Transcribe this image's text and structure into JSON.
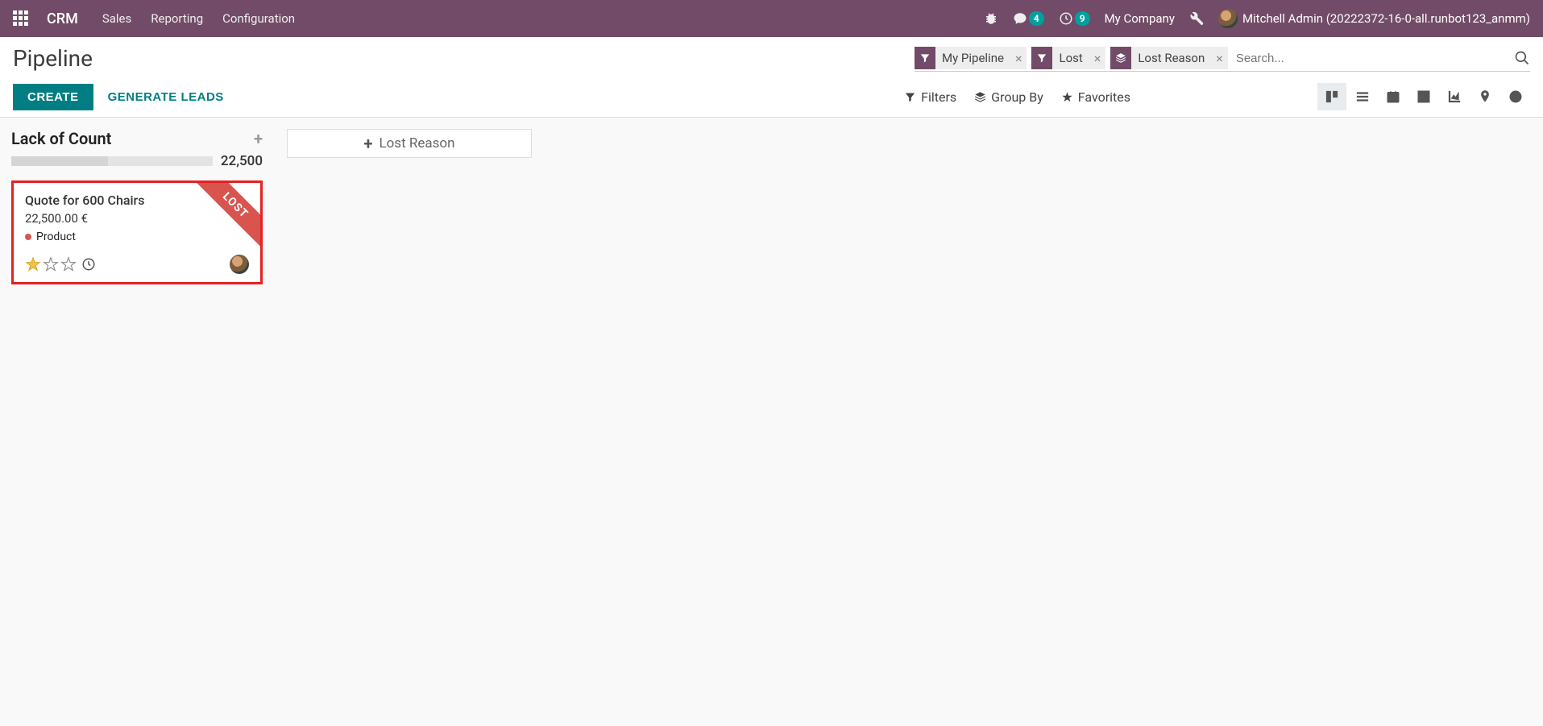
{
  "navbar": {
    "brand": "CRM",
    "links": [
      "Sales",
      "Reporting",
      "Configuration"
    ],
    "messages_badge": "4",
    "activities_badge": "9",
    "company": "My Company",
    "user": "Mitchell Admin (20222372-16-0-all.runbot123_anmm)"
  },
  "page": {
    "title": "Pipeline",
    "create": "CREATE",
    "generate_leads": "GENERATE LEADS"
  },
  "search": {
    "facets": [
      {
        "icon": "filter",
        "label": "My Pipeline"
      },
      {
        "icon": "filter",
        "label": "Lost"
      },
      {
        "icon": "group",
        "label": "Lost Reason"
      }
    ],
    "placeholder": "Search..."
  },
  "toolbar": {
    "filters": "Filters",
    "group_by": "Group By",
    "favorites": "Favorites"
  },
  "kanban": {
    "column_title": "Lack of Count",
    "column_sum": "22,500",
    "card": {
      "title": "Quote for 600 Chairs",
      "amount": "22,500.00 €",
      "tag": "Product",
      "ribbon": "LOST"
    },
    "add_column_label": "Lost Reason"
  }
}
